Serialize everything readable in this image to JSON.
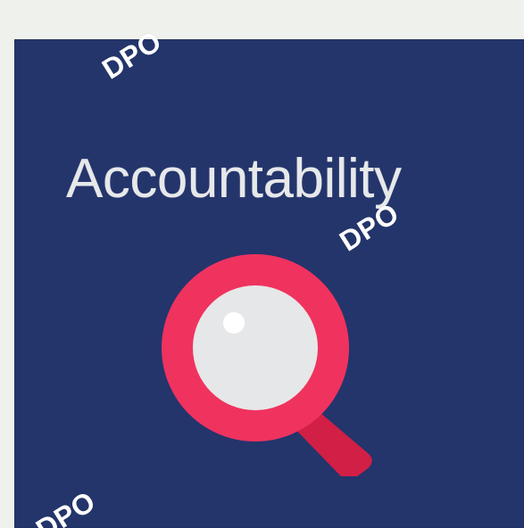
{
  "slide": {
    "title": "Accountability",
    "icon": "magnifying-glass-icon",
    "watermark": "DPO"
  },
  "colors": {
    "page_bg": "#eef1ec",
    "tile_bg": "#23356b",
    "title_text": "#e7e8ea",
    "icon_ring": "#f0325f",
    "icon_lens": "#e6e7e8",
    "icon_handle": "#d21f45",
    "watermark": "#ffffff"
  }
}
